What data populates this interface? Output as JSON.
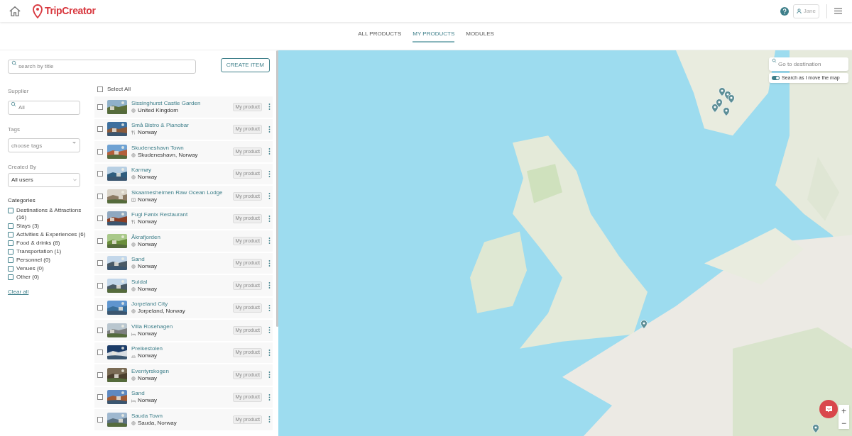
{
  "header": {
    "logo": "TripCreator",
    "user": "Jane"
  },
  "tabs": [
    {
      "label": "ALL PRODUCTS",
      "selected": false
    },
    {
      "label": "MY PRODUCTS",
      "selected": true
    },
    {
      "label": "MODULES",
      "selected": false
    }
  ],
  "search": {
    "placeholder": "search by title"
  },
  "create_button": "CREATE ITEM",
  "filters": {
    "supplier": {
      "label": "Supplier",
      "placeholder": "All"
    },
    "tags": {
      "label": "Tags",
      "placeholder": "choose tags"
    },
    "created_by": {
      "label": "Created By",
      "value": "All users"
    }
  },
  "categories": {
    "title": "Categories",
    "items": [
      {
        "label": "Destinations & Attractions (16)",
        "checked": false
      },
      {
        "label": "Stays (3)",
        "checked": false
      },
      {
        "label": "Activities & Experiences (6)",
        "checked": false
      },
      {
        "label": "Food & drinks (8)",
        "checked": false
      },
      {
        "label": "Transportation (1)",
        "checked": false
      },
      {
        "label": "Personnel (0)",
        "checked": false
      },
      {
        "label": "Venues (0)",
        "checked": false
      },
      {
        "label": "Other (0)",
        "checked": false
      }
    ],
    "clear": "Clear all"
  },
  "select_all": {
    "label": "Select All",
    "checked": false
  },
  "products": [
    {
      "title": "Sissinghurst Castle Garden",
      "location": "United Kingdom",
      "kind": "place",
      "badge": "My product",
      "checked": false
    },
    {
      "title": "Små Bistro & Pianobar",
      "location": "Norway",
      "kind": "food",
      "badge": "My product",
      "checked": false
    },
    {
      "title": "Skudeneshavn Town",
      "location": "Skudeneshavn, Norway",
      "kind": "place",
      "badge": "My product",
      "checked": false
    },
    {
      "title": "Karmøy",
      "location": "Norway",
      "kind": "place",
      "badge": "My product",
      "checked": false
    },
    {
      "title": "Skaarnesheimen Raw Ocean Lodge",
      "location": "Norway",
      "kind": "lodge",
      "badge": "My product",
      "checked": false
    },
    {
      "title": "Fugl Fønix Restaurant",
      "location": "Norway",
      "kind": "food",
      "badge": "My product",
      "checked": false
    },
    {
      "title": "Åkrafjorden",
      "location": "Norway",
      "kind": "place",
      "badge": "My product",
      "checked": false
    },
    {
      "title": "Sand",
      "location": "Norway",
      "kind": "place",
      "badge": "My product",
      "checked": false
    },
    {
      "title": "Suldal",
      "location": "Norway",
      "kind": "place",
      "badge": "My product",
      "checked": false
    },
    {
      "title": "Jorpeland City",
      "location": "Jorpeland, Norway",
      "kind": "place",
      "badge": "My product",
      "checked": false
    },
    {
      "title": "Villa Rosehagen",
      "location": "Norway",
      "kind": "stay",
      "badge": "My product",
      "checked": false
    },
    {
      "title": "Preikestolen",
      "location": "Norway",
      "kind": "nature",
      "badge": "My product",
      "checked": false
    },
    {
      "title": "Eventyrskogen",
      "location": "Norway",
      "kind": "place",
      "badge": "My product",
      "checked": false
    },
    {
      "title": "Sand",
      "location": "Norway",
      "kind": "stay",
      "badge": "My product",
      "checked": false
    },
    {
      "title": "Sauda Town",
      "location": "Sauda, Norway",
      "kind": "place",
      "badge": "My product",
      "checked": false
    }
  ],
  "map": {
    "search": {
      "placeholder": "Go to destination"
    },
    "toggle": {
      "label": "Search as I move the map",
      "on": true
    },
    "zoom_in": "+",
    "zoom_out": "−"
  }
}
